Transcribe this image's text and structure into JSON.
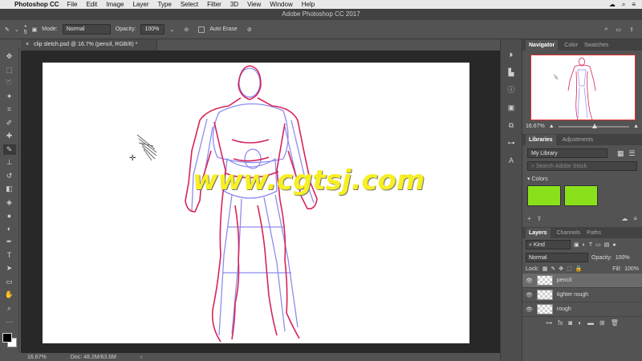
{
  "menubar": {
    "app_name": "Photoshop CC",
    "items": [
      "File",
      "Edit",
      "Image",
      "Layer",
      "Type",
      "Select",
      "Filter",
      "3D",
      "View",
      "Window",
      "Help"
    ]
  },
  "window": {
    "title": "Adobe Photoshop CC 2017"
  },
  "options": {
    "brush_size": "5",
    "mode_label": "Mode:",
    "mode_value": "Normal",
    "opacity_label": "Opacity:",
    "opacity_value": "100%",
    "auto_erase_label": "Auto Erase"
  },
  "document": {
    "tab_title": "clip sletch.psd @ 16.7% (pencil, RGB/8) *",
    "status_zoom": "16.67%",
    "status_doc": "Doc: 48.2M/63.6M",
    "status_arrow": "›"
  },
  "watermark": "www.cgtsj.com",
  "navigator": {
    "tabs": [
      "Navigator",
      "Color",
      "Swatches"
    ],
    "zoom": "16.67%"
  },
  "libraries": {
    "tabs": [
      "Libraries",
      "Adjustments"
    ],
    "library_name": "My Library",
    "search_placeholder": "Search Adobe Stock",
    "colors_label": "Colors",
    "swatch_colors": [
      "#8ae11b",
      "#8ae11b"
    ]
  },
  "layers": {
    "tabs": [
      "Layers",
      "Channels",
      "Paths"
    ],
    "kind_label": "Kind",
    "blend_mode": "Normal",
    "opacity_label": "Opacity:",
    "opacity_value": "100%",
    "lock_label": "Lock:",
    "fill_label": "Fill:",
    "fill_value": "100%",
    "items": [
      {
        "name": "pencil",
        "selected": true
      },
      {
        "name": "tighter rough",
        "selected": false
      },
      {
        "name": "rough",
        "selected": false
      }
    ]
  },
  "colors": {
    "accent_green": "#8ae11b",
    "sketch_red": "#d6245a",
    "sketch_blue": "#8e8cf0",
    "watermark_yellow": "#f7ef23"
  }
}
